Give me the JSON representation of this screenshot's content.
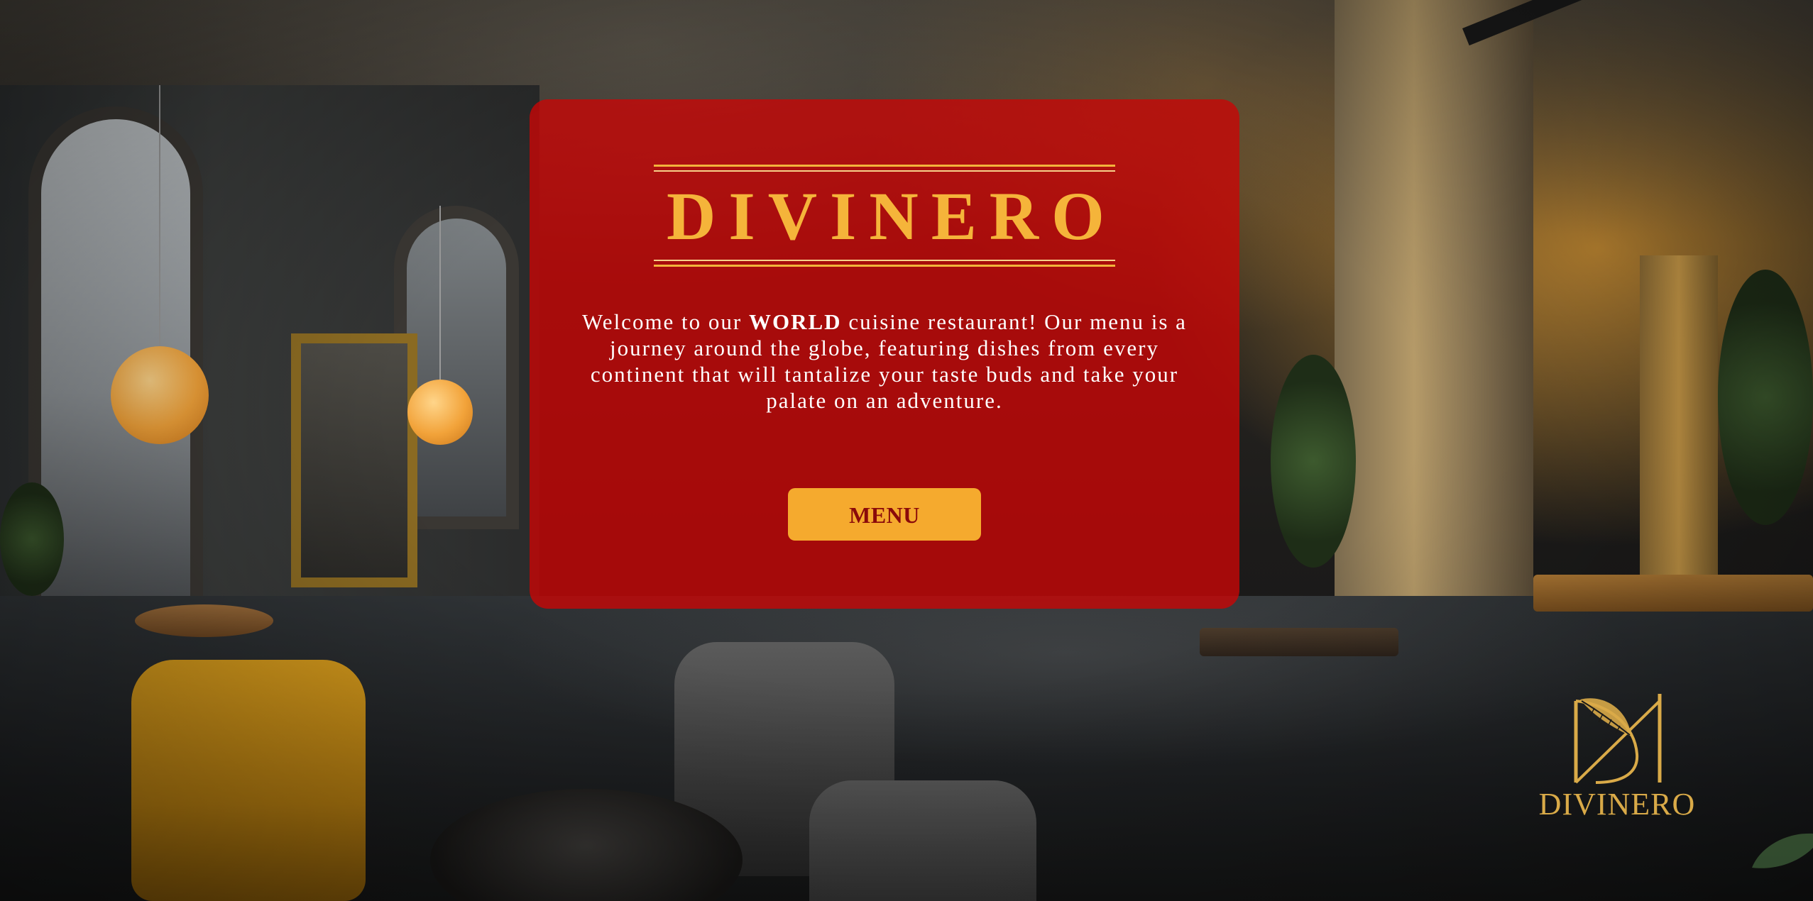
{
  "hero": {
    "brand_name": "DIVINERO",
    "intro_pre": "Welcome to our ",
    "intro_bold": "WORLD",
    "intro_post": " cuisine restaurant! Our menu is a journey around the globe, featuring dishes from every continent that will tantalize your taste buds and take your palate on an adventure.",
    "menu_button_label": "MENU"
  },
  "logo": {
    "wordmark": "DIVINERO",
    "icon": "leaf-monogram-icon"
  },
  "colors": {
    "card_red": "#c80606",
    "accent_gold": "#f5aa2e",
    "button_text": "#8a0a0a",
    "logo_gold": "#d9aa48"
  }
}
